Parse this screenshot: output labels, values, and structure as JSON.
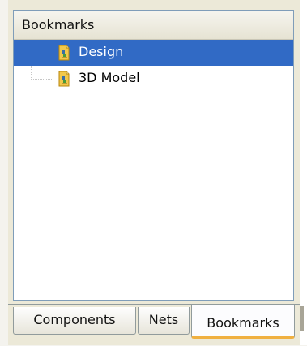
{
  "panel": {
    "header": "Bookmarks"
  },
  "tree": {
    "items": [
      {
        "label": "Design",
        "icon": "bookmark-page-icon",
        "selected": true
      },
      {
        "label": "3D Model",
        "icon": "bookmark-page-icon",
        "selected": false
      }
    ]
  },
  "tabs": [
    {
      "label": "Components",
      "active": false
    },
    {
      "label": "Nets",
      "active": false
    },
    {
      "label": "Bookmarks",
      "active": true
    }
  ],
  "colors": {
    "selection": "#316ac5",
    "active_tab_underline": "#f0b040",
    "frame_border": "#7f9db9"
  }
}
